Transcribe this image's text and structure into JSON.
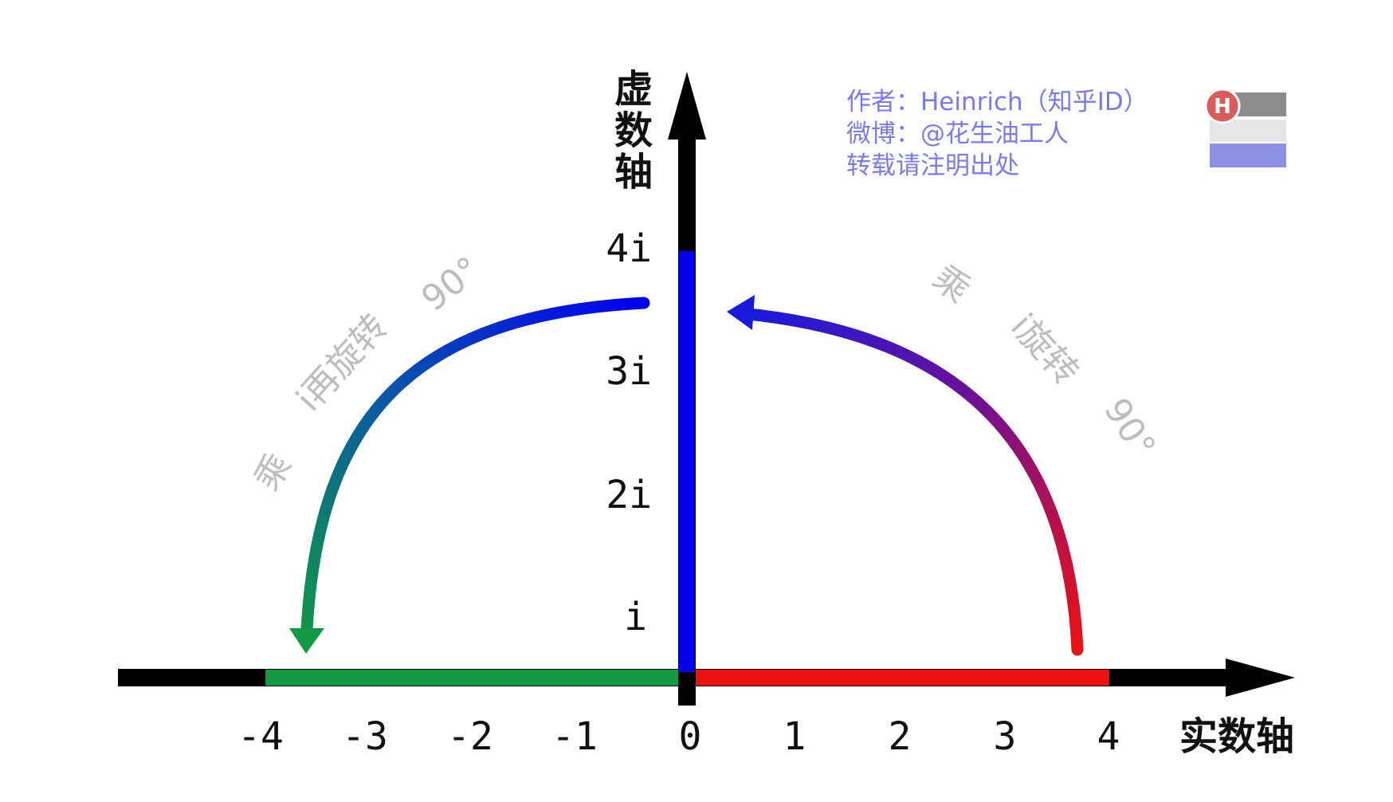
{
  "axes": {
    "real_label": "实数轴",
    "imag_label_chars": [
      "虚",
      "数",
      "轴"
    ]
  },
  "real_ticks": [
    "-4",
    "-3",
    "-2",
    "-1",
    "0",
    "1",
    "2",
    "3",
    "4"
  ],
  "imag_ticks": [
    "i",
    "2i",
    "3i",
    "4i"
  ],
  "arcs": {
    "right_label_parts": [
      "乘",
      "i旋转",
      "90°"
    ],
    "left_label_parts": [
      "乘",
      "i再旋转",
      "90°"
    ]
  },
  "credit": {
    "line1": "作者：Heinrich（知乎ID）",
    "line2": "微博：@花生油工人",
    "line3": "转载请注明出处"
  },
  "logo": {
    "letter": "H"
  },
  "colors": {
    "axis": "#000000",
    "real_positive": "#ee1111",
    "real_negative": "#119944",
    "imag_segment": "#0000ee",
    "arc_right_start": "#ee1111",
    "arc_right_end": "#1a1add",
    "arc_left_start": "#0000ee",
    "arc_left_end": "#119944",
    "arc_label": "#bdbdbd",
    "credit_text": "#7a7af0"
  }
}
